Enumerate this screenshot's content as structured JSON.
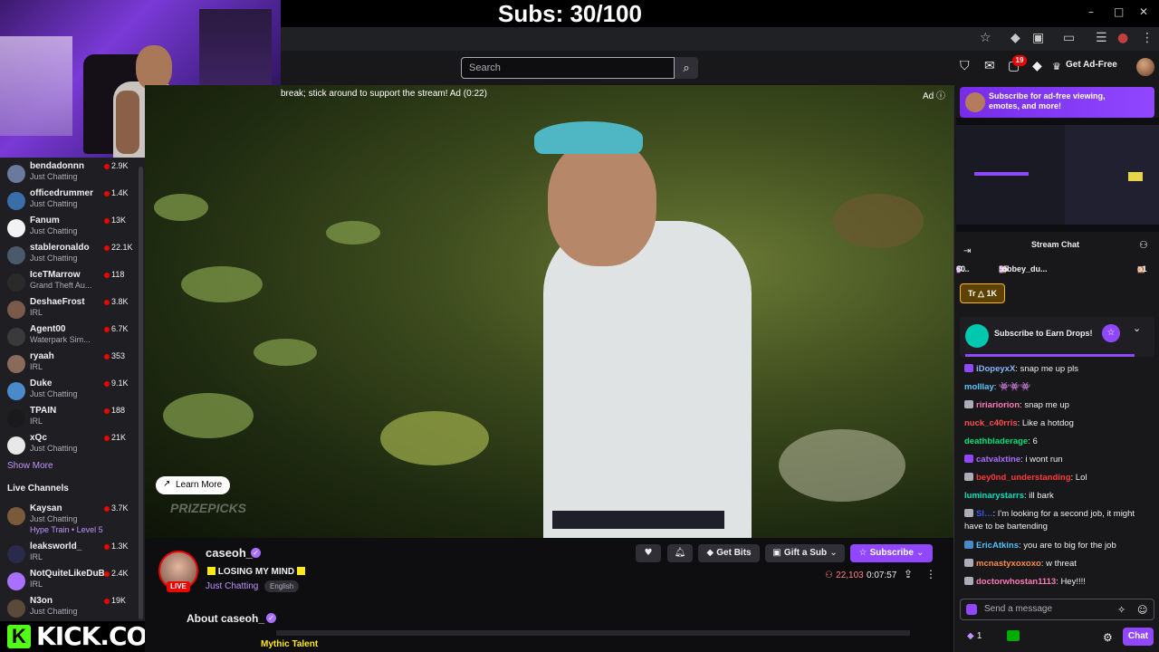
{
  "overlay": {
    "subs_goal": "Subs: 30/100",
    "kick_url": "KICK.COM/SKINNY",
    "kick_logo": "K"
  },
  "window": {
    "minimize": "–",
    "maximize": "□",
    "close": "✕"
  },
  "browser": {
    "icons": [
      "star-icon",
      "extension-icon",
      "puzzle-icon",
      "media-icon",
      "reading-list-icon",
      "profile-icon",
      "menu-icon"
    ]
  },
  "nav": {
    "search_placeholder": "Search",
    "notifications_count": "19",
    "get_ad_free": "Get Ad-Free"
  },
  "sidebar": {
    "followed": [
      {
        "name": "bendadonnn",
        "game": "Just Chatting",
        "viewers": "2.9K",
        "color": "#6b7a9a"
      },
      {
        "name": "officedrummer",
        "game": "Just Chatting",
        "viewers": "1.4K",
        "color": "#3a6ea8"
      },
      {
        "name": "Fanum",
        "game": "Just Chatting",
        "viewers": "13K",
        "color": "#f2f2f2"
      },
      {
        "name": "stableronaldo",
        "game": "Just Chatting",
        "viewers": "22.1K",
        "color": "#4a5a6a"
      },
      {
        "name": "IceTMarrow",
        "game": "Grand Theft Au...",
        "viewers": "118",
        "color": "#2a2a2a"
      },
      {
        "name": "DeshaeFrost",
        "game": "IRL",
        "viewers": "3.8K",
        "color": "#7a5a4a"
      },
      {
        "name": "Agent00",
        "game": "Waterpark Sim...",
        "viewers": "6.7K",
        "color": "#3a3a3a"
      },
      {
        "name": "ryaah",
        "game": "IRL",
        "viewers": "353",
        "color": "#8a6a5a"
      },
      {
        "name": "Duke",
        "game": "Just Chatting",
        "viewers": "9.1K",
        "color": "#4a8acb"
      },
      {
        "name": "TPAIN",
        "game": "IRL",
        "viewers": "188",
        "color": "#1a1a1a"
      },
      {
        "name": "xQc",
        "game": "Just Chatting",
        "viewers": "21K",
        "color": "#e8e8e8"
      }
    ],
    "show_more": "Show More",
    "live_channels_title": "Live Channels",
    "live": [
      {
        "name": "Kaysan",
        "game": "Just Chatting",
        "sub": "Hype Train • Level 5",
        "viewers": "3.7K",
        "color": "#7a5a3a"
      },
      {
        "name": "leaksworld_",
        "game": "IRL",
        "viewers": "1.3K",
        "color": "#2a2a4a"
      },
      {
        "name": "NotQuiteLikeDuB",
        "game": "IRL",
        "viewers": "2.4K",
        "color": "#a970ff"
      },
      {
        "name": "N3on",
        "game": "Just Chatting",
        "viewers": "19K",
        "color": "#5a4a3a"
      }
    ]
  },
  "video": {
    "ad_message": "break; stick around to support the stream! Ad (0:22)",
    "ad_label": "Ad ⓘ",
    "learn_more": "Learn More",
    "sponsor": "PRIZEPICKS"
  },
  "channel": {
    "name": "caseoh_",
    "live": "LIVE",
    "title": "LOSING MY MIND",
    "category": "Just Chatting",
    "language": "English",
    "follow_icon": "♥",
    "bell_icon": "⍾",
    "get_bits": "Get Bits",
    "gift_sub": "Gift a Sub",
    "subscribe": "Subscribe",
    "viewers": "22,103",
    "uptime": "0:07:57",
    "about": "About caseoh_",
    "mythic": "Mythic Talent"
  },
  "chat": {
    "sub_banner": "Subscribe for ad-free viewing, emotes, and more!",
    "title": "Stream Chat",
    "leaderboard": [
      {
        "name": "O...",
        "amount": "60"
      },
      {
        "name": "rubbey_du...",
        "amount": "55"
      },
      {
        "name": "o1",
        "amount": ""
      }
    ],
    "hype": "Tr △ 1K",
    "drops": "Subscribe to Earn Drops!",
    "messages": [
      {
        "user": "iDopeyxX",
        "color": "#8ab4f8",
        "text": ": snap me up pls",
        "badge": "#9147ff"
      },
      {
        "user": "molllay",
        "color": "#5ac8fa",
        "text": ": 👾👾👾",
        "badge": ""
      },
      {
        "user": "ririariorion",
        "color": "#ff7ab7",
        "text": ": snap me up",
        "badge": "#adadb8"
      },
      {
        "user": "nuck_c40rris",
        "color": "#ff4f4f",
        "text": ": Like a hotdog",
        "badge": ""
      },
      {
        "user": "deathbladerage",
        "color": "#00e07a",
        "text": ": 6",
        "badge": ""
      },
      {
        "user": "catvalxtine",
        "color": "#a970ff",
        "text": ": i wont run",
        "badge": "#9147ff"
      },
      {
        "user": "bey0nd_understanding",
        "color": "#ff3b3b",
        "text": ": Lol",
        "badge": "#adadb8"
      },
      {
        "user": "luminarystarrs",
        "color": "#00e0c0",
        "text": ": ill bark",
        "badge": ""
      },
      {
        "user": "Sl…",
        "color": "#3a5adf",
        "text": ": I'm looking for a second job, it might have to be bartending",
        "badge": "#adadb8"
      },
      {
        "user": "EricAtkins",
        "color": "#4fc3f7",
        "text": ": you are to big for the job",
        "badge": "#4a8acb"
      },
      {
        "user": "mcnastyxoxoxo",
        "color": "#ff8a4a",
        "text": ": w threat",
        "badge": "#adadb8"
      },
      {
        "user": "doctorwhostan1113",
        "color": "#ff7ab7",
        "text": ": Hey!!!!",
        "badge": "#adadb8"
      }
    ],
    "input_placeholder": "Send a message",
    "points": "1",
    "chat_button": "Chat"
  }
}
